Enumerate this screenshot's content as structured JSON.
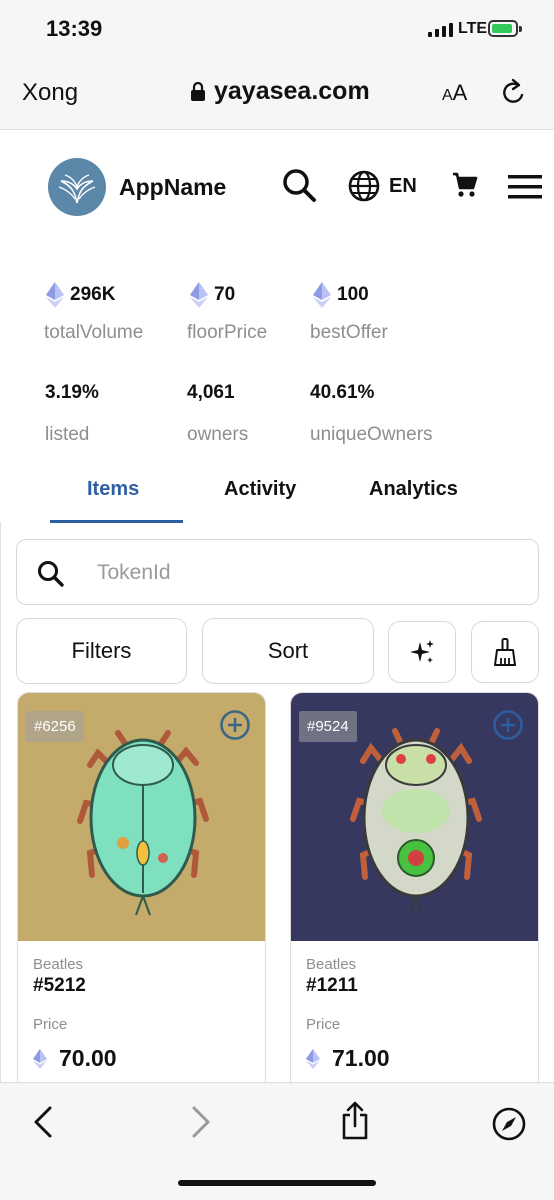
{
  "status_bar": {
    "time": "13:39",
    "network": "LTE"
  },
  "browser": {
    "done_label": "Xong",
    "url": "yayasea.com",
    "text_size_label": "AA"
  },
  "header": {
    "app_name": "AppName",
    "language": "EN"
  },
  "stats": [
    {
      "value": "296K",
      "label": "totalVolume",
      "eth": true
    },
    {
      "value": "70",
      "label": "floorPrice",
      "eth": true
    },
    {
      "value": "100",
      "label": "bestOffer",
      "eth": true
    },
    {
      "value": "3.19%",
      "label": "listed",
      "eth": false
    },
    {
      "value": "4,061",
      "label": "owners",
      "eth": false
    },
    {
      "value": "40.61%",
      "label": "uniqueOwners",
      "eth": false
    }
  ],
  "tabs": [
    {
      "label": "Items",
      "active": true
    },
    {
      "label": "Activity",
      "active": false
    },
    {
      "label": "Analytics",
      "active": false
    }
  ],
  "search": {
    "placeholder": "TokenId",
    "value": ""
  },
  "controls": {
    "filters_label": "Filters",
    "sort_label": "Sort"
  },
  "items": [
    {
      "badge": "#6256",
      "collection": "Beatles",
      "token": "#5212",
      "price_label": "Price",
      "price": "70.00",
      "bg_color": "#c4ab6c",
      "body_color": "#7fe0c0"
    },
    {
      "badge": "#9524",
      "collection": "Beatles",
      "token": "#1211",
      "price_label": "Price",
      "price": "71.00",
      "bg_color": "#363860",
      "body_color": "#d4d8c8"
    }
  ],
  "colors": {
    "accent": "#2f5fa3",
    "logo_bg": "#5b88a8"
  }
}
